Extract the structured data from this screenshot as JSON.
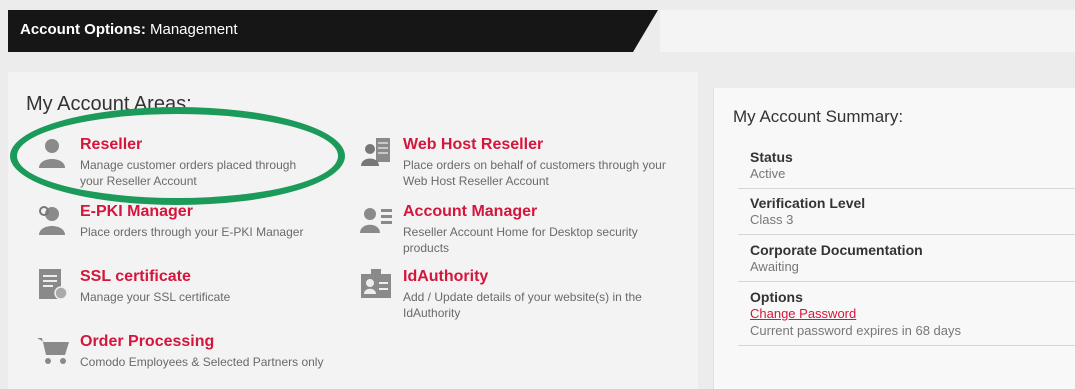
{
  "header": {
    "title_bold": "Account Options:",
    "title_rest": " Management"
  },
  "areas": {
    "heading": "My Account Areas:",
    "items": [
      {
        "title": "Reseller",
        "desc": "Manage customer orders placed through your Reseller Account",
        "icon": "user-icon"
      },
      {
        "title": "Web Host Reseller",
        "desc": "Place orders on behalf of customers through your Web Host Reseller Account",
        "icon": "server-user-icon"
      },
      {
        "title": "E-PKI Manager",
        "desc": "Place orders through your E-PKI Manager",
        "icon": "user-key-icon"
      },
      {
        "title": "Account Manager",
        "desc": "Reseller Account Home for Desktop security products",
        "icon": "user-list-icon"
      },
      {
        "title": "SSL certificate",
        "desc": "Manage your SSL certificate",
        "icon": "certificate-icon"
      },
      {
        "title": "IdAuthority",
        "desc": "Add / Update details of your website(s) in the IdAuthority",
        "icon": "id-badge-icon"
      },
      {
        "title": "Order Processing",
        "desc": "Comodo Employees & Selected Partners only",
        "icon": "cart-icon"
      }
    ]
  },
  "summary": {
    "heading": "My Account Summary:",
    "status_label": "Status",
    "status_value": "Active",
    "verification_label": "Verification Level",
    "verification_value": "Class 3",
    "corpdoc_label": "Corporate Documentation",
    "corpdoc_value": "Awaiting",
    "options_label": "Options",
    "change_password": "Change Password",
    "password_note": "Current password expires in 68 days"
  },
  "colors": {
    "accent": "#d4163c",
    "highlight": "#1c9a5a",
    "header_bg": "#161616"
  }
}
